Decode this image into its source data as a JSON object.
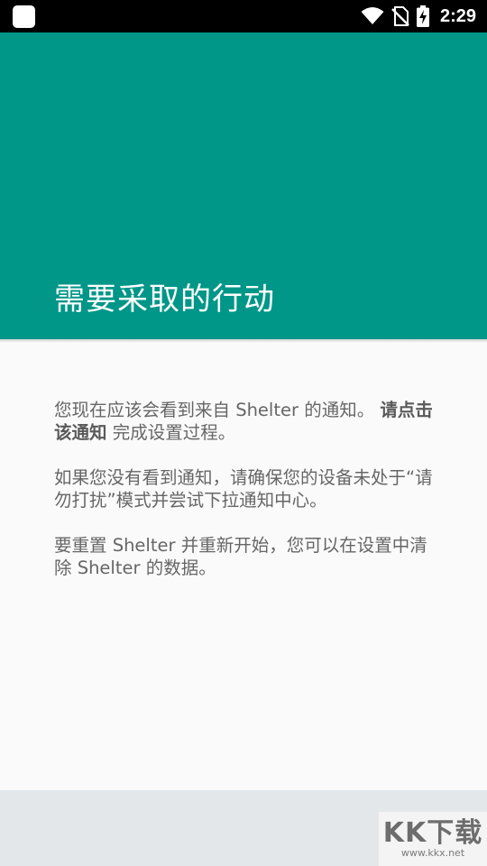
{
  "status_bar": {
    "time": "2:29",
    "icons": [
      "app-notification-icon",
      "wifi-icon",
      "no-sim-icon",
      "battery-charging-icon"
    ]
  },
  "header": {
    "title": "需要采取的行动"
  },
  "content": {
    "para1_text": "您现在应该会看到来自 Shelter 的通知。 ",
    "para1_bold": "请点击该通知",
    "para1_tail": " 完成设置过程。",
    "para2": "如果您没有看到通知，请确保您的设备未处于“请勿打扰”模式并尝试下拉通知中心。",
    "para3": "要重置 Shelter 并重新开始，您可以在设置中清除 Shelter 的数据。"
  },
  "watermark": {
    "logo": "KK下载",
    "url": "www.kkx.net"
  },
  "colors": {
    "header": "#009688",
    "background": "#fafafa",
    "bottom_bar": "#e4e7ea"
  }
}
